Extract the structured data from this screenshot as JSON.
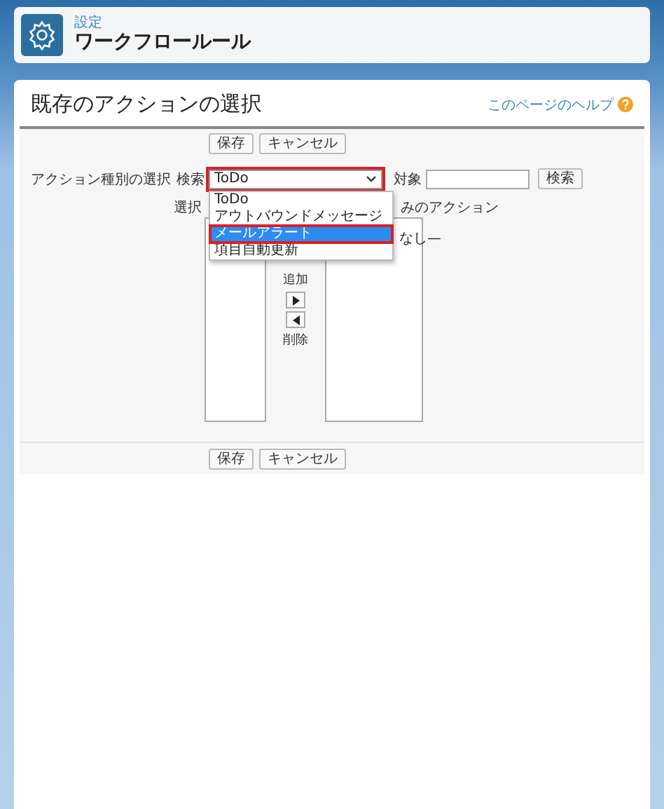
{
  "header": {
    "breadcrumb": "設定",
    "title": "ワークフロールール"
  },
  "page": {
    "title": "既存のアクションの選択",
    "help_link": "このページのヘルプ"
  },
  "top_buttons": [
    "保存",
    "キャンセル"
  ],
  "action_type": {
    "label": "アクション種別の選択",
    "search_label": "検索",
    "selected_value": "ToDo",
    "highlighted": true,
    "target_label": "対象",
    "search_button": "検索"
  },
  "dropdown": {
    "options": [
      {
        "label": "ToDo",
        "selected": false
      },
      {
        "label": "アウトバウンドメッセージ",
        "selected": false
      },
      {
        "label": "メールアラート",
        "selected": true
      },
      {
        "label": "項目自動更新",
        "selected": false
      }
    ]
  },
  "available": {
    "heading": "選択"
  },
  "selected_list": {
    "heading": "みのアクション",
    "items": [
      "なし—"
    ]
  },
  "add_label": "追加",
  "remove_label": "削除",
  "bottom_buttons": [
    "保存",
    "キャンセル"
  ]
}
